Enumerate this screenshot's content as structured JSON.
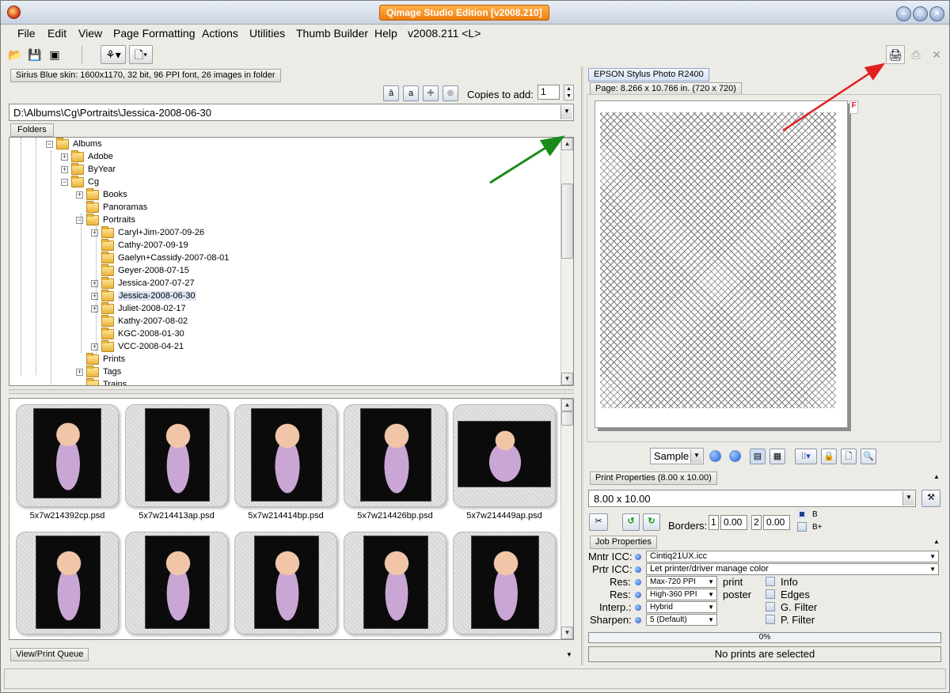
{
  "window": {
    "title": "Qimage Studio Edition [v2008.210]",
    "controls": [
      "minimize-icon",
      "maximize-icon",
      "close-icon"
    ]
  },
  "menu": [
    "File",
    "Edit",
    "View",
    "Page Formatting",
    "Actions",
    "Utilities",
    "Thumb Builder",
    "Help",
    "v2008.211 <L>"
  ],
  "left": {
    "skin_info": "Sirius Blue skin: 1600x1170, 32 bit, 96 PPI font, 26 images in folder",
    "copies_label": "Copies to add:",
    "copies_value": "1",
    "path": "D:\\Albums\\Cg\\Portraits\\Jessica-2008-06-30",
    "folders_tab": "Folders",
    "tree": [
      {
        "label": "Albums",
        "exp": "−"
      },
      {
        "label": "Adobe",
        "exp": "+"
      },
      {
        "label": "ByYear",
        "exp": "+"
      },
      {
        "label": "Cg",
        "exp": "−"
      },
      {
        "label": "Books",
        "exp": "+"
      },
      {
        "label": "Panoramas",
        "exp": ""
      },
      {
        "label": "Portraits",
        "exp": "−"
      },
      {
        "label": "Caryl+Jim-2007-09-26",
        "exp": "+"
      },
      {
        "label": "Cathy-2007-09-19",
        "exp": ""
      },
      {
        "label": "Gaelyn+Cassidy-2007-08-01",
        "exp": ""
      },
      {
        "label": "Geyer-2008-07-15",
        "exp": ""
      },
      {
        "label": "Jessica-2007-07-27",
        "exp": "+"
      },
      {
        "label": "Jessica-2008-06-30",
        "exp": "+"
      },
      {
        "label": "Juliet-2008-02-17",
        "exp": "+"
      },
      {
        "label": "Kathy-2007-08-02",
        "exp": ""
      },
      {
        "label": "KGC-2008-01-30",
        "exp": ""
      },
      {
        "label": "VCC-2008-04-21",
        "exp": "+"
      },
      {
        "label": "Prints",
        "exp": ""
      },
      {
        "label": "Tags",
        "exp": "+"
      },
      {
        "label": "Trains",
        "exp": ""
      }
    ],
    "thumbnails": [
      {
        "caption": "5x7w214392cp.psd"
      },
      {
        "caption": "5x7w214413ap.psd"
      },
      {
        "caption": "5x7w214414bp.psd"
      },
      {
        "caption": "5x7w214426bp.psd"
      },
      {
        "caption": "5x7w214449ap.psd"
      },
      {
        "caption": ""
      },
      {
        "caption": ""
      },
      {
        "caption": ""
      },
      {
        "caption": ""
      },
      {
        "caption": ""
      }
    ],
    "queue_tab": "View/Print Queue"
  },
  "right": {
    "printer_tab": "EPSON Stylus Photo R2400",
    "page_tab": "Page: 8.266 x 10.766 in.  (720 x 720)",
    "flag": "F",
    "sample_label": "Sample",
    "print_props_tab": "Print Properties (8.00 x 10.00)",
    "size_value": "8.00 x 10.00",
    "borders_label": "Borders:",
    "border1_num": "1",
    "border1_val": "0.00",
    "border2_num": "2",
    "border2_val": "0.00",
    "b_label": "B",
    "bplus_label": "B+",
    "job_props_tab": "Job Properties",
    "mntr_label": "Mntr ICC:",
    "mntr_value": "Cintiq21UX.icc",
    "prtr_label": "Prtr ICC:",
    "prtr_value": "Let printer/driver manage color",
    "res1_label": "Res:",
    "res1_value": "Max-720 PPI",
    "res1_after": "print",
    "res2_label": "Res:",
    "res2_value": "High-360 PPI",
    "res2_after": "poster",
    "interp_label": "Interp.:",
    "interp_value": "Hybrid",
    "sharpen_label": "Sharpen:",
    "sharpen_value": "5 (Default)",
    "checks": [
      "Info",
      "Edges",
      "G. Filter",
      "P. Filter"
    ],
    "progress_text": "0%",
    "status_text": "No prints are selected"
  },
  "colors": {
    "title_badge": "#f07e10",
    "annotation_red": "#e02020",
    "annotation_green": "#1a8a1a"
  }
}
